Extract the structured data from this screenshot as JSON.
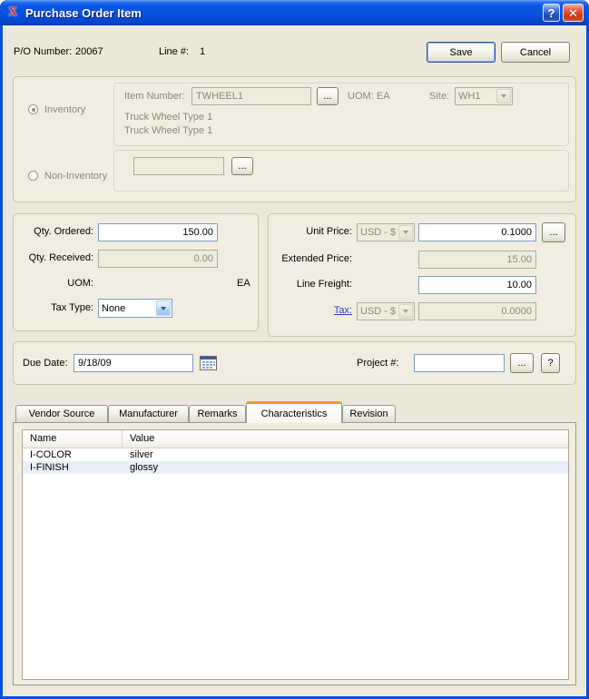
{
  "window": {
    "title": "Purchase Order Item",
    "app_icon_glyph": "X",
    "help_glyph": "?",
    "close_glyph": "✕"
  },
  "header": {
    "po_number_label": "P/O Number:",
    "po_number_value": "20067",
    "line_number_label": "Line #:",
    "line_number_value": "1",
    "save_label": "Save",
    "cancel_label": "Cancel"
  },
  "item": {
    "inventory_label": "Inventory",
    "non_inventory_label": "Non-Inventory",
    "item_number_label": "Item Number:",
    "item_number_value": "TWHEEL1",
    "browse_label": "...",
    "uom_label": "UOM:",
    "uom_value": "EA",
    "site_label": "Site:",
    "site_value": "WH1",
    "description_line1": "Truck Wheel Type 1",
    "description_line2": "Truck Wheel Type 1",
    "non_inventory_value": ""
  },
  "quantity": {
    "qty_ordered_label": "Qty. Ordered:",
    "qty_ordered_value": "150.00",
    "qty_received_label": "Qty. Received:",
    "qty_received_value": "0.00",
    "uom_label": "UOM:",
    "uom_value": "EA",
    "tax_type_label": "Tax Type:",
    "tax_type_value": "None"
  },
  "price": {
    "unit_price_label": "Unit Price:",
    "unit_price_currency": "USD - $",
    "unit_price_value": "0.1000",
    "browse_label": "...",
    "extended_price_label": "Extended Price:",
    "extended_price_value": "15.00",
    "line_freight_label": "Line Freight:",
    "line_freight_value": "10.00",
    "tax_label": "Tax:",
    "tax_currency": "USD - $",
    "tax_value": "0.0000"
  },
  "schedule": {
    "due_date_label": "Due Date:",
    "due_date_value": "9/18/09",
    "project_label": "Project #:",
    "project_value": "",
    "browse_label": "...",
    "help_label": "?"
  },
  "tabs": {
    "active": "Characteristics",
    "items": [
      {
        "label": "Vendor Source"
      },
      {
        "label": "Manufacturer"
      },
      {
        "label": "Remarks"
      },
      {
        "label": "Characteristics"
      },
      {
        "label": "Revision"
      }
    ]
  },
  "characteristics": {
    "columns": [
      "Name",
      "Value"
    ],
    "rows": [
      {
        "name": "I-COLOR",
        "value": "silver"
      },
      {
        "name": "I-FINISH",
        "value": "glossy"
      }
    ]
  }
}
